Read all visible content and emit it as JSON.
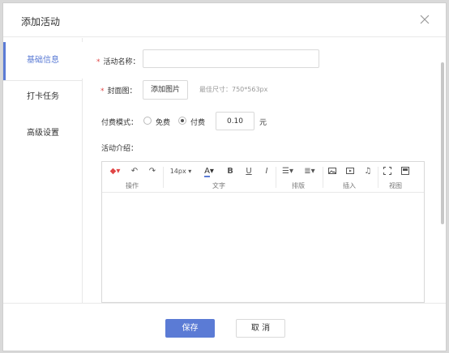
{
  "dialog": {
    "title": "添加活动"
  },
  "sidebar": {
    "items": [
      {
        "label": "基础信息",
        "active": true
      },
      {
        "label": "打卡任务"
      },
      {
        "label": "高级设置"
      }
    ]
  },
  "form": {
    "name_label": "活动名称：",
    "name_value": "",
    "cover_label": "封面图：",
    "add_image_label": "添加图片",
    "cover_hint": "最佳尺寸：750*563px",
    "pay_mode_label": "付费模式：",
    "free_label": "免费",
    "paid_label": "付费",
    "price_value": "0.10",
    "price_unit": "元",
    "intro_label": "活动介绍："
  },
  "toolbar": {
    "font_size": "14px",
    "groups": [
      "操作",
      "文字",
      "排版",
      "插入",
      "视图"
    ]
  },
  "footer": {
    "save_label": "保存",
    "cancel_label": "取 消"
  },
  "colors": {
    "accent": "#5b7bd5",
    "required": "#e04646"
  }
}
